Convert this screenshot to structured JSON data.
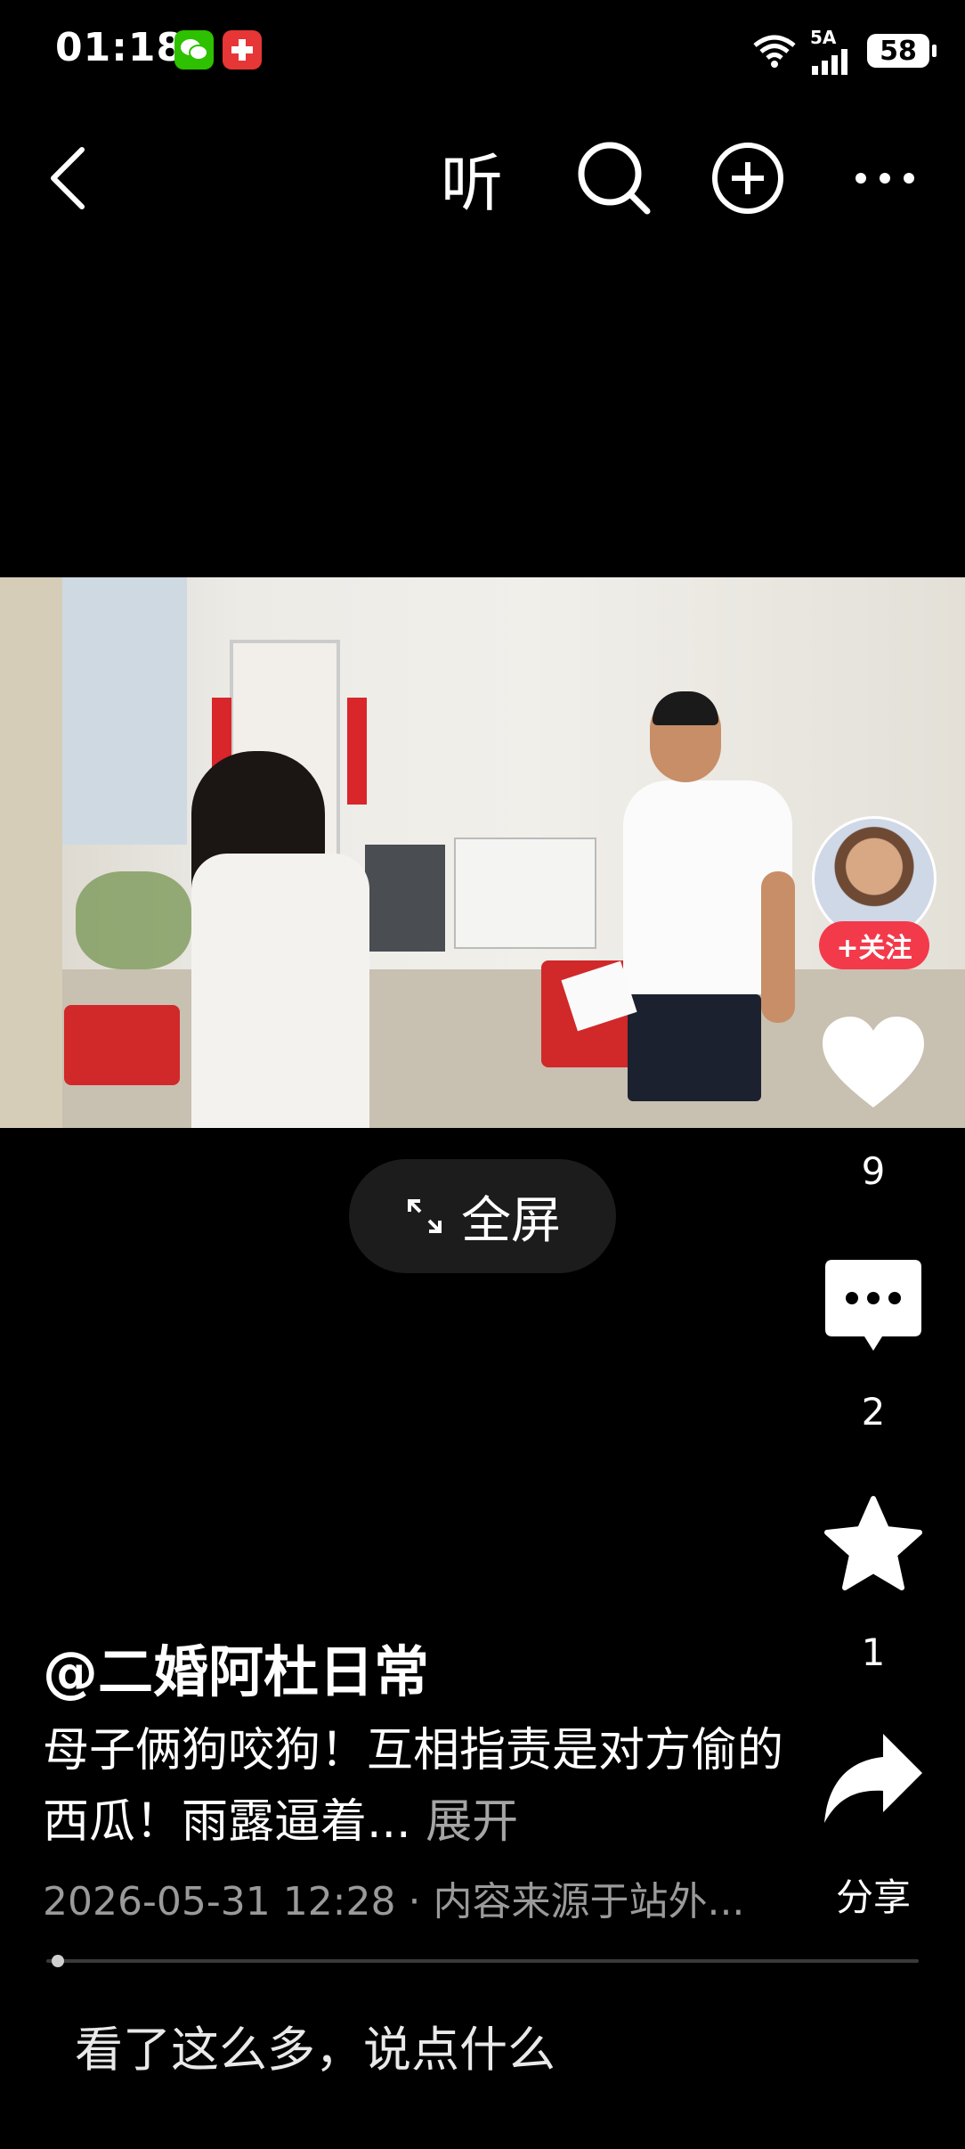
{
  "status_bar": {
    "time": "01:18",
    "network": "5A",
    "battery": "58",
    "icons": [
      "wechat-icon",
      "app-notification-icon",
      "wifi-icon",
      "signal-icon",
      "battery-icon"
    ]
  },
  "top_bar": {
    "back_icon": "back-arrow-icon",
    "listen_label": "听",
    "search_icon": "search-icon",
    "add_icon": "plus-circle-icon",
    "more_icon": "more-dots-icon"
  },
  "video": {
    "fullscreen_label": "全屏"
  },
  "right_rail": {
    "follow_label": "+关注",
    "like_count": "9",
    "comment_count": "2",
    "favorite_count": "1",
    "share_label": "分享"
  },
  "caption": {
    "author": "@二婚阿杜日常",
    "description": "母子俩狗咬狗！互相指责是对方偷的西瓜！雨露逼着...",
    "expand_label": "展开",
    "meta": "2026-05-31 12:28 · 内容来源于站外..."
  },
  "comment_bar": {
    "placeholder": "看了这么多，说点什么"
  },
  "colors": {
    "background": "#000000",
    "follow_button": "#f33a4b",
    "muted_text": "#9a9a9a"
  }
}
